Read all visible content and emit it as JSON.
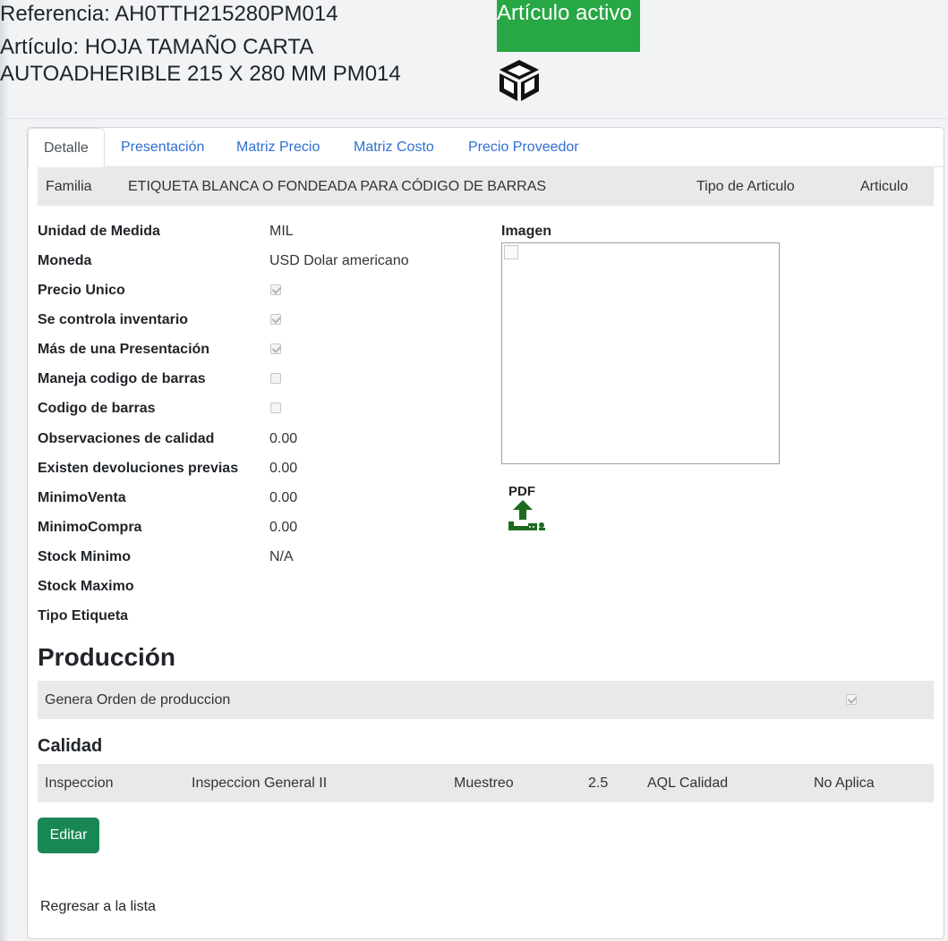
{
  "header": {
    "referencia": "Referencia: AH0TTH215280PM014",
    "articulo": "Artículo: HOJA TAMAÑO CARTA AUTOADHERIBLE 215 X 280 MM PM014",
    "badge": "Artículo activo",
    "badge_color": "#28a745",
    "product_icon": "cube-icon"
  },
  "tabs": [
    {
      "label": "Detalle",
      "active": true
    },
    {
      "label": "Presentación",
      "active": false
    },
    {
      "label": "Matriz Precio",
      "active": false
    },
    {
      "label": "Matriz Costo",
      "active": false
    },
    {
      "label": "Precio Proveedor",
      "active": false
    }
  ],
  "familia": {
    "label": "Familia",
    "value": "ETIQUETA BLANCA O FONDEADA PARA CÓDIGO DE BARRAS",
    "tipo_label": "Tipo de Articulo",
    "tipo_value": "Articulo"
  },
  "fields": [
    {
      "label": "Unidad de Medida",
      "value": "MIL"
    },
    {
      "label": "Moneda",
      "value": "USD Dolar americano"
    },
    {
      "label": "Precio Unico",
      "checked": true
    },
    {
      "label": "Se controla inventario",
      "checked": true
    },
    {
      "label": "Más de una Presentación",
      "checked": true
    },
    {
      "label": "Maneja codigo de barras",
      "checked": false
    },
    {
      "label": "Codigo de barras",
      "checked": false
    },
    {
      "label": "Observaciones de calidad",
      "value": "0.00"
    },
    {
      "label": "Existen devoluciones previas",
      "value": "0.00"
    },
    {
      "label": "MinimoVenta",
      "value": "0.00"
    },
    {
      "label": "MinimoCompra",
      "value": "0.00"
    },
    {
      "label": "Stock Minimo",
      "value": "N/A"
    },
    {
      "label": "Stock Maximo",
      "value": ""
    },
    {
      "label": "Tipo Etiqueta",
      "value": ""
    }
  ],
  "imagen": {
    "label": "Imagen"
  },
  "pdf": {
    "label": "PDF",
    "icon": "upload-icon",
    "color": "#1e6b1e"
  },
  "produccion": {
    "title": "Producción",
    "genera_label": "Genera Orden de produccion",
    "genera_checked": true
  },
  "calidad": {
    "title": "Calidad",
    "inspeccion_label": "Inspeccion",
    "inspeccion_value": "Inspeccion General II",
    "muestreo_label": "Muestreo",
    "muestreo_value": "2.5",
    "aql_label": "AQL Calidad",
    "aql_value": "No Aplica"
  },
  "actions": {
    "edit_label": "Editar",
    "edit_color": "#198754",
    "back_label": "Regresar a la lista"
  }
}
